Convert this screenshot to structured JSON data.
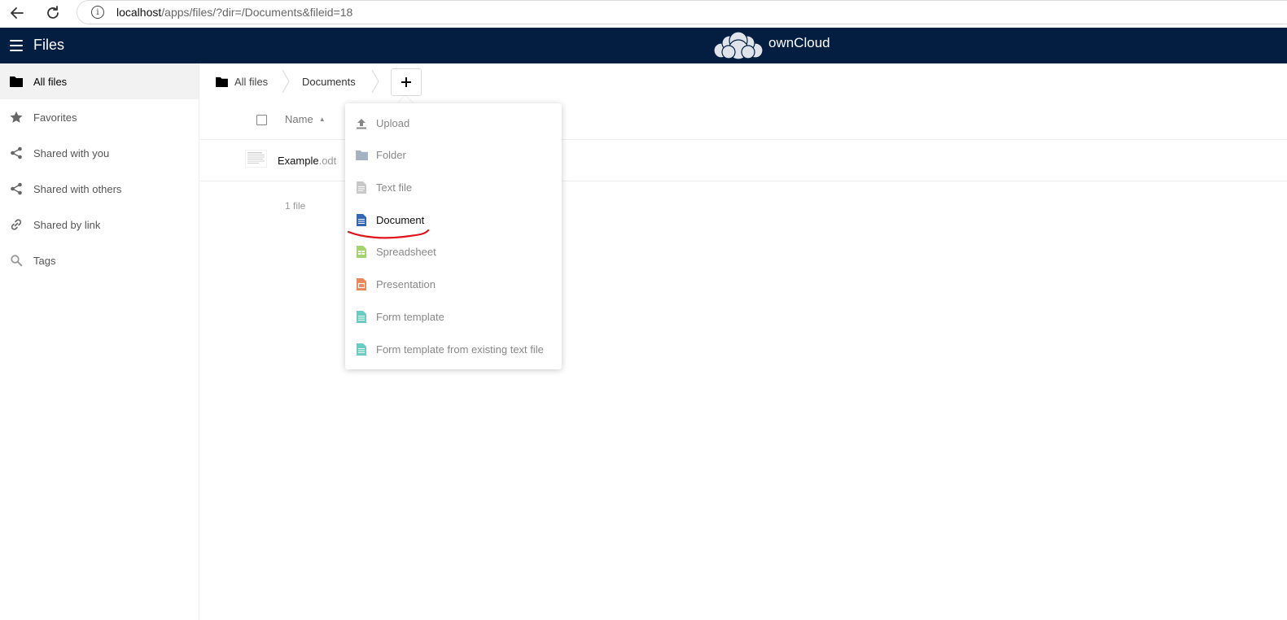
{
  "browser": {
    "url_host": "localhost",
    "url_path": "/apps/files/?dir=/Documents&fileid=18"
  },
  "header": {
    "app_title": "Files",
    "brand_name": "ownCloud"
  },
  "sidebar": {
    "items": [
      {
        "label": "All files",
        "icon": "folder-icon",
        "active": true
      },
      {
        "label": "Favorites",
        "icon": "star-icon"
      },
      {
        "label": "Shared with you",
        "icon": "share-icon"
      },
      {
        "label": "Shared with others",
        "icon": "share-icon"
      },
      {
        "label": "Shared by link",
        "icon": "link-icon"
      },
      {
        "label": "Tags",
        "icon": "search-icon"
      }
    ]
  },
  "breadcrumb": {
    "items": [
      {
        "label": "All files",
        "icon": "folder-icon"
      },
      {
        "label": "Documents"
      }
    ],
    "add_button": "+"
  },
  "table": {
    "column_name": "Name",
    "sort": "ascending",
    "files": [
      {
        "basename": "Example",
        "extension": ".odt"
      }
    ],
    "summary": "1 file"
  },
  "new_menu": {
    "items": [
      {
        "label": "Upload",
        "icon": "upload-icon",
        "color": "#888888"
      },
      {
        "label": "Folder",
        "icon": "folder-icon",
        "color": "#a3b1c2"
      },
      {
        "label": "Text file",
        "icon": "text-file-icon",
        "color": "#bbbbbb"
      },
      {
        "label": "Document",
        "icon": "document-icon",
        "color": "#3566b3",
        "highlighted": true
      },
      {
        "label": "Spreadsheet",
        "icon": "spreadsheet-icon",
        "color": "#9ccc65"
      },
      {
        "label": "Presentation",
        "icon": "presentation-icon",
        "color": "#e8875a"
      },
      {
        "label": "Form template",
        "icon": "form-template-icon",
        "color": "#6ccbc3"
      },
      {
        "label": "Form template from existing text file",
        "icon": "form-template-icon",
        "color": "#6ccbc3"
      }
    ]
  },
  "colors": {
    "header_bg": "#041e42",
    "annotation": "#e0131a"
  }
}
